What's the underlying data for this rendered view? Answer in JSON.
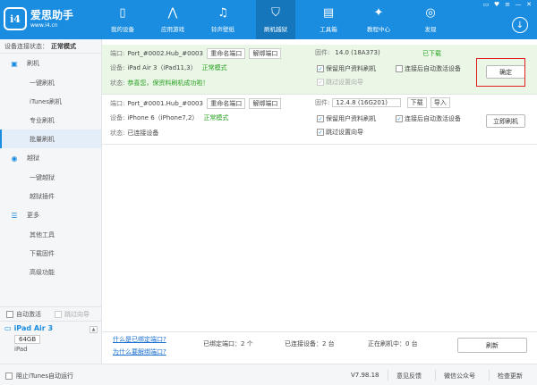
{
  "app": {
    "logo_mark": "i4",
    "title": "爱思助手",
    "url": "www.i4.cn"
  },
  "nav": [
    {
      "label": "我的设备",
      "icon": "phone-icon",
      "glyph": "▯"
    },
    {
      "label": "应用游戏",
      "icon": "app-store-icon",
      "glyph": "⋀"
    },
    {
      "label": "铃声壁纸",
      "icon": "music-icon",
      "glyph": "♫"
    },
    {
      "label": "刷机越狱",
      "icon": "shield-icon",
      "glyph": "⛉"
    },
    {
      "label": "工具箱",
      "icon": "toolbox-icon",
      "glyph": "▤"
    },
    {
      "label": "教程中心",
      "icon": "graduation-cap-icon",
      "glyph": "✦"
    },
    {
      "label": "发现",
      "icon": "compass-icon",
      "glyph": "◎"
    }
  ],
  "window_controls": [
    "▭",
    "♥",
    "≡",
    "—",
    "✕"
  ],
  "download_glyph": "↓",
  "sidebar": {
    "conn_label": "设备连接状态：",
    "conn_mode": "正常模式",
    "flash_section": "刷机",
    "flash_items": [
      "一键刷机",
      "iTunes刷机",
      "专业刷机",
      "批量刷机"
    ],
    "jb_section": "越狱",
    "jb_items": [
      "一键越狱",
      "越狱插件"
    ],
    "more_section": "更多",
    "more_items": [
      "其他工具",
      "下载固件",
      "高级功能"
    ],
    "auto_activate": "自动激活",
    "skip_guide": "跳过向导",
    "device_name": "iPad Air 3",
    "device_capacity": "64GB",
    "device_type": "iPad"
  },
  "rows": [
    {
      "port_label": "端口:",
      "port": "Port_#0002.Hub_#0003",
      "rename": "重命名端口",
      "unbind": "解绑端口",
      "device_label": "设备:",
      "device": "iPad Air 3（iPad11,3）",
      "mode": "正常模式",
      "status_label": "状态:",
      "status": "恭喜您，保资料刷机成功啦！",
      "fw_label": "固件:",
      "fw": "14.0 (18A373)",
      "fw_status": "已下载",
      "keep_data": "保留用户资料刷机",
      "auto_act": "连接后自动激活设备",
      "skip": "跳过设置向导",
      "action": "确定"
    },
    {
      "port_label": "端口:",
      "port": "Port_#0001.Hub_#0003",
      "rename": "重命名端口",
      "unbind": "解绑端口",
      "device_label": "设备:",
      "device": "iPhone 6（iPhone7,2）",
      "mode": "正常模式",
      "status_label": "状态:",
      "status": "已连接设备",
      "fw_label": "固件:",
      "fw": "12.4.8 (16G201)",
      "download": "下载",
      "import": "导入",
      "keep_data": "保留用户资料刷机",
      "auto_act": "连接后自动激活设备",
      "skip": "跳过设置向导",
      "action": "立即刷机"
    }
  ],
  "status_bar": {
    "q1": "什么是已绑定端口?",
    "q2": "为什么要解绑端口?",
    "bound": "已绑定端口：2 个",
    "connected": "已连接设备：2 台",
    "flashing": "正在刷机中：0 台",
    "refresh": "刷新"
  },
  "footer": {
    "block_itunes": "阻止iTunes自动运行",
    "version": "V7.98.18",
    "feedback": "意见反馈",
    "wechat": "微信公众号",
    "update": "检查更新"
  }
}
